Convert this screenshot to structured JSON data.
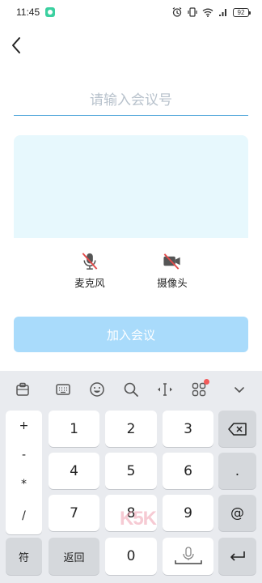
{
  "status_bar": {
    "time": "11:45",
    "battery": "92",
    "icons": [
      "app-notification-icon",
      "alarm-icon",
      "vibrate-icon",
      "wifi-icon",
      "signal-icon",
      "battery-icon"
    ]
  },
  "header": {
    "back_icon": "chevron-left-icon"
  },
  "meeting_input": {
    "placeholder": "请输入会议号",
    "value": ""
  },
  "preview": {
    "background_color": "#e7f8fd"
  },
  "controls": {
    "mic_label": "麦克风",
    "camera_label": "摄像头",
    "mic_icon": "mic-off-icon",
    "camera_icon": "camera-off-icon",
    "off_color": "#e24b4b"
  },
  "join_button": {
    "label": "加入会议",
    "color": "#a9dbfb"
  },
  "keyboard": {
    "toolbar_icons": [
      "clipboard-icon",
      "keyboard-icon",
      "emoji-icon",
      "search-icon",
      "cursor-move-icon",
      "apps-icon",
      "collapse-icon"
    ],
    "symbols": [
      "+",
      "-",
      "*",
      "/"
    ],
    "digits_row1": [
      "1",
      "2",
      "3"
    ],
    "digits_row2": [
      "4",
      "5",
      "6"
    ],
    "digits_row3": [
      "7",
      "8",
      "9"
    ],
    "right_keys": [
      ".",
      "@"
    ],
    "bottom": {
      "symbols_label": "符",
      "back_label": "返回",
      "zero": "0"
    },
    "action_icons": [
      "backspace-icon",
      "space-mic-icon",
      "enter-icon"
    ]
  },
  "watermark": {
    "text": "K5K"
  }
}
